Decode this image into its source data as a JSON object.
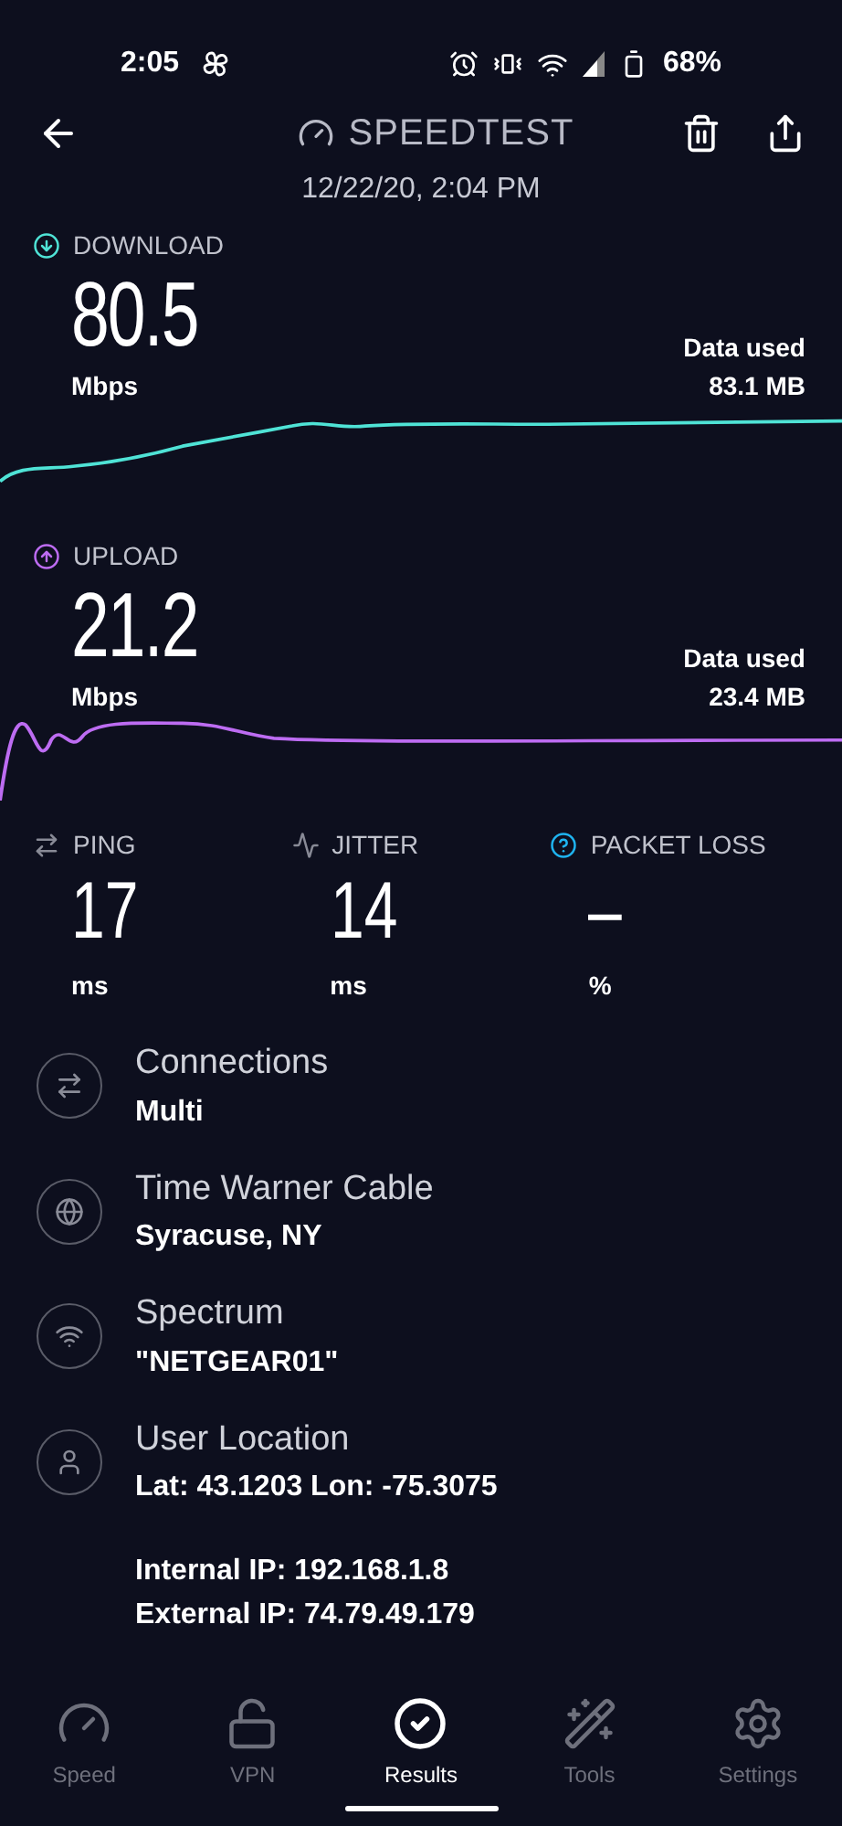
{
  "status_bar": {
    "time": "2:05",
    "battery": "68%"
  },
  "header": {
    "title": "SPEEDTEST",
    "date": "12/22/20, 2:04 PM"
  },
  "metrics": [
    {
      "kind": "download",
      "label": "DOWNLOAD",
      "value": "80.5",
      "unit": "Mbps",
      "data_label": "Data used",
      "data_value": "83.1 MB",
      "color": "#4fe3d6"
    },
    {
      "kind": "upload",
      "label": "UPLOAD",
      "value": "21.2",
      "unit": "Mbps",
      "data_label": "Data used",
      "data_value": "23.4 MB",
      "color": "#bd6cf2"
    }
  ],
  "stats": [
    {
      "kind": "ping",
      "label": "PING",
      "value": "17",
      "unit": "ms"
    },
    {
      "kind": "jitter",
      "label": "JITTER",
      "value": "14",
      "unit": "ms"
    },
    {
      "kind": "packet_loss",
      "label": "PACKET LOSS",
      "value": "–",
      "unit": "%"
    }
  ],
  "details": [
    {
      "kind": "connections",
      "title": "Connections",
      "lines": [
        "Multi"
      ]
    },
    {
      "kind": "provider",
      "title": "Time Warner Cable",
      "lines": [
        "Syracuse, NY"
      ]
    },
    {
      "kind": "wifi",
      "title": "Spectrum",
      "lines": [
        "\"NETGEAR01\""
      ]
    },
    {
      "kind": "location",
      "title": "User Location",
      "lines": [
        "Lat: 43.1203 Lon: -75.3075"
      ]
    }
  ],
  "ips": [
    "Internal IP: 192.168.1.8",
    "External IP: 74.79.49.179"
  ],
  "nav": [
    {
      "kind": "speed",
      "label": "Speed",
      "selected": false
    },
    {
      "kind": "vpn",
      "label": "VPN",
      "selected": false
    },
    {
      "kind": "results",
      "label": "Results",
      "selected": true
    },
    {
      "kind": "tools",
      "label": "Tools",
      "selected": false
    },
    {
      "kind": "settings",
      "label": "Settings",
      "selected": false
    }
  ]
}
